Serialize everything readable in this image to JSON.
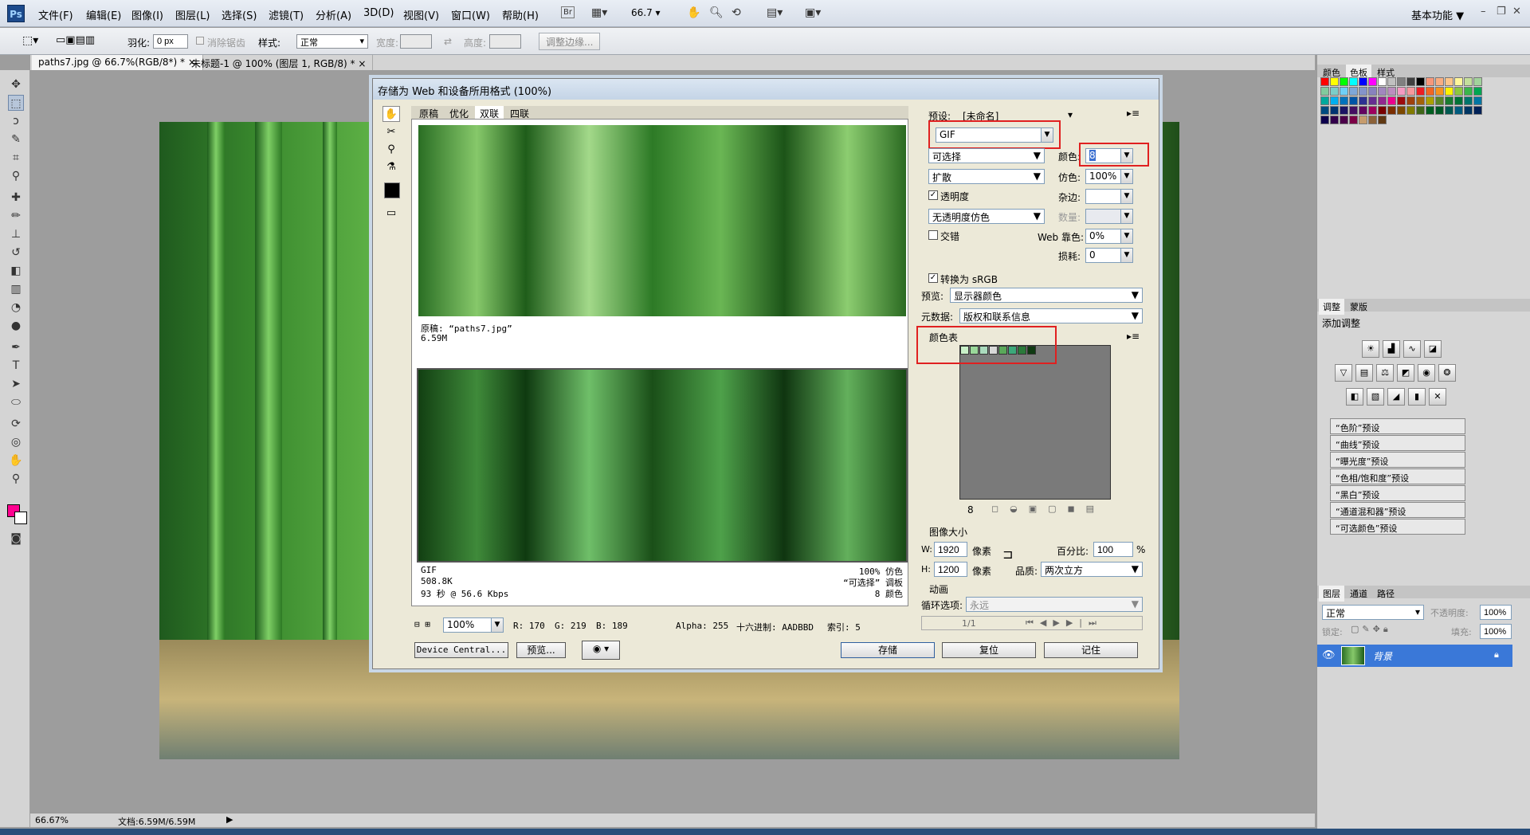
{
  "app": {
    "logo": "Ps"
  },
  "menu": [
    "文件(F)",
    "编辑(E)",
    "图像(I)",
    "图层(L)",
    "选择(S)",
    "滤镜(T)",
    "分析(A)",
    "3D(D)",
    "视图(V)",
    "窗口(W)",
    "帮助(H)"
  ],
  "top": {
    "zoom": "66.7",
    "workspace": "基本功能 ▼",
    "bridge": "Br"
  },
  "options": {
    "feather_label": "羽化:",
    "feather_value": "0 px",
    "antialias": "消除锯齿",
    "style_label": "样式:",
    "style_value": "正常",
    "width_label": "宽度:",
    "height_label": "高度:",
    "refine_button": "调整边缘..."
  },
  "tabs": [
    {
      "label": "paths7.jpg @ 66.7%(RGB/8*) * ×",
      "active": true
    },
    {
      "label": "未标题-1 @ 100% (图层 1, RGB/8) * ×",
      "active": false
    }
  ],
  "dialog": {
    "title": "存储为 Web 和设备所用格式 (100%)",
    "view_tabs": [
      "原稿",
      "优化",
      "双联",
      "四联"
    ],
    "orig_info": {
      "name": "原稿: “paths7.jpg”",
      "size": "6.59M"
    },
    "opt_info": {
      "format": "GIF",
      "size": "508.8K",
      "time": "93 秒 @ 56.6 Kbps",
      "dither": "100% 仿色",
      "palette": "“可选择” 调板",
      "colors": "8 颜色"
    },
    "bottom": {
      "zoom": "100%",
      "r": "R: 170",
      "g": "G: 219",
      "b": "B: 189",
      "alpha": "Alpha: 255",
      "hex": "十六进制: AADBBD",
      "index": "索引: 5"
    },
    "buttons": {
      "device_central": "Device Central...",
      "preview": "预览...",
      "save": "存储",
      "reset": "复位",
      "remember": "记住"
    },
    "preset_label": "预设:",
    "preset_value": "[未命名]",
    "format": "GIF",
    "reduction": "可选择",
    "colors_label": "颜色:",
    "colors_value": "8",
    "dither_method": "扩散",
    "dither_label": "仿色:",
    "dither_value": "100%",
    "transparency": "透明度",
    "matte_label": "杂边:",
    "trans_dither": "无透明度仿色",
    "amount_label": "数量:",
    "interlaced": "交错",
    "websnap_label": "Web 靠色:",
    "websnap_value": "0%",
    "lossy_label": "损耗:",
    "lossy_value": "0",
    "convert_srgb": "转换为 sRGB",
    "preview_label": "预览:",
    "preview_value": "显示器颜色",
    "metadata_label": "元数据:",
    "metadata_value": "版权和联系信息",
    "color_table_label": "颜色表",
    "color_count": "8",
    "swatches": [
      "#c8f0c8",
      "#9ad89a",
      "#aadbbd",
      "#d8d8d8",
      "#5aa85a",
      "#3ca87a",
      "#2a7a3a",
      "#0f3a12"
    ],
    "image_size_label": "图像大小",
    "w_label": "W:",
    "w_value": "1920",
    "h_label": "H:",
    "h_value": "1200",
    "px": "像素",
    "percent_label": "百分比:",
    "percent_value": "100",
    "percent_unit": "%",
    "quality_label": "品质:",
    "quality_value": "两次立方",
    "animation_label": "动画",
    "loop_label": "循环选项:",
    "loop_value": "永远",
    "frame": "1/1"
  },
  "panels": {
    "top_tabs": [
      "颜色",
      "色板",
      "样式"
    ],
    "adj_tabs": [
      "调整",
      "蒙版"
    ],
    "adj_title": "添加调整",
    "presets": [
      "“色阶”预设",
      "“曲线”预设",
      "“曝光度”预设",
      "“色相/饱和度”预设",
      "“黑白”预设",
      "“通道混和器”预设",
      "“可选颜色”预设"
    ],
    "layer_tabs": [
      "图层",
      "通道",
      "路径"
    ],
    "blend": "正常",
    "opacity_label": "不透明度:",
    "opacity": "100%",
    "lock_label": "锁定:",
    "fill_label": "填充:",
    "fill": "100%",
    "layer_name": "背景"
  },
  "status": {
    "zoom": "66.67%",
    "doc": "文档:6.59M/6.59M"
  },
  "colors": {
    "foreground": "#ff0090",
    "background": "#ffffff",
    "accent": "#e02020"
  }
}
